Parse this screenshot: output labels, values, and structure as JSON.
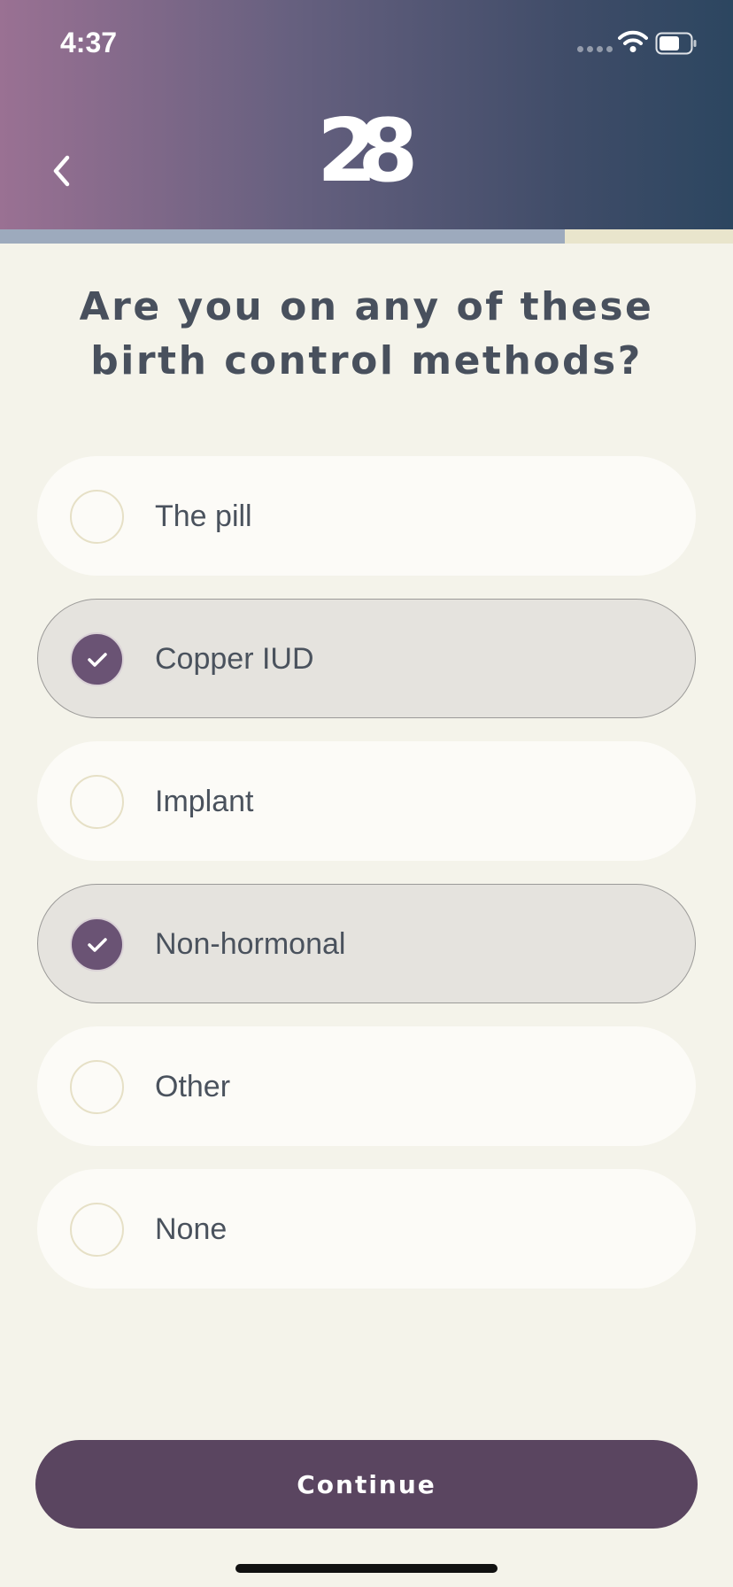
{
  "status_bar": {
    "time": "4:37"
  },
  "header": {
    "logo_text": "28"
  },
  "progress": {
    "fraction": 0.77
  },
  "question": "Are you on any of these birth control methods?",
  "options": [
    {
      "label": "The pill",
      "selected": false
    },
    {
      "label": "Copper IUD",
      "selected": true
    },
    {
      "label": "Implant",
      "selected": false
    },
    {
      "label": "Non-hormonal",
      "selected": true
    },
    {
      "label": "Other",
      "selected": false
    },
    {
      "label": "None",
      "selected": false
    }
  ],
  "continue_label": "Continue",
  "icons": {
    "back": "chevron-left-icon",
    "check": "checkmark-icon",
    "wifi": "wifi-icon",
    "battery": "battery-icon"
  },
  "colors": {
    "header_gradient": [
      "#9a7193",
      "#2c4660"
    ],
    "accent": "#5a4560",
    "progress_fill": "#9daabd",
    "background": "#f4f3ea"
  }
}
